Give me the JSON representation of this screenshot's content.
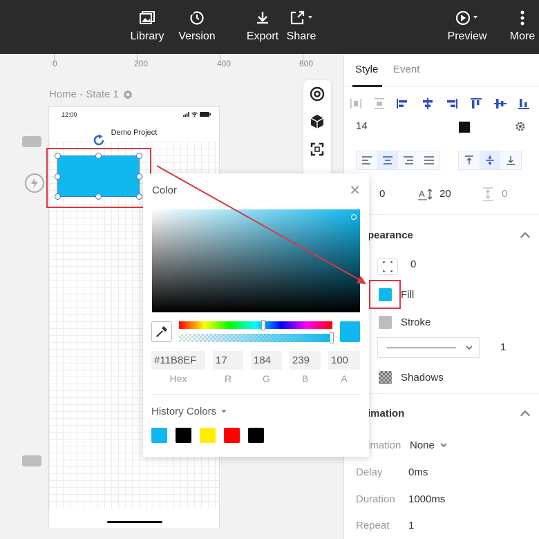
{
  "toolbar": {
    "items": [
      {
        "label": "Library",
        "icon": "image-icon"
      },
      {
        "label": "Version",
        "icon": "history-icon"
      },
      {
        "label": "Export",
        "icon": "download-icon"
      },
      {
        "label": "Share",
        "icon": "share-icon"
      },
      {
        "label": "Preview",
        "icon": "play-icon"
      },
      {
        "label": "More",
        "icon": "more-vertical-icon"
      }
    ]
  },
  "ruler": {
    "labels": [
      "0",
      "200",
      "400",
      "600"
    ]
  },
  "canvas": {
    "state_title": "Home - State 1",
    "phone": {
      "time": "12:00",
      "title": "Demo Project"
    },
    "selected_fill": "#11B8EF"
  },
  "color_picker": {
    "title": "Color",
    "hex": "#11B8EF",
    "r": "17",
    "g": "184",
    "b": "239",
    "a": "100",
    "labels": {
      "hex": "Hex",
      "r": "R",
      "g": "G",
      "b": "B",
      "a": "A"
    },
    "history_title": "History Colors",
    "history_colors": [
      "#11B8EF",
      "#000000",
      "#FFEE00",
      "#FF0000",
      "#000000"
    ]
  },
  "right_panel": {
    "tabs": [
      "Style",
      "Event"
    ],
    "font_size": "14",
    "letter_spacing": "0",
    "line_height": "20",
    "paragraph_spacing": "0",
    "appearance": {
      "title": "pearance",
      "corner_radius": "0",
      "fill_label": "Fill",
      "fill_color": "#11B8EF",
      "stroke_label": "Stroke",
      "stroke_width": "1",
      "shadows_label": "Shadows"
    },
    "animation": {
      "title": "imation",
      "animation_label": "imation",
      "animation_value": "None",
      "delay_label": "Delay",
      "delay_value": "0ms",
      "duration_label": "Duration",
      "duration_value": "1000ms",
      "repeat_label": "Repeat",
      "repeat_value": "1"
    }
  }
}
